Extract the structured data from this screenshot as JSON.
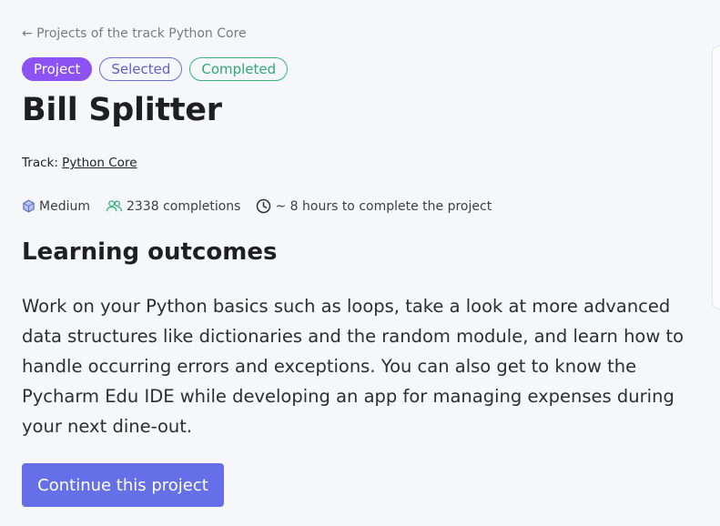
{
  "nav": {
    "back_label": "← Projects of the track Python Core"
  },
  "badges": {
    "project": "Project",
    "selected": "Selected",
    "completed": "Completed"
  },
  "project": {
    "title": "Bill Splitter",
    "track_label": "Track:",
    "track_name": "Python Core"
  },
  "meta": {
    "difficulty": "Medium",
    "completions": "2338 completions",
    "duration": "~ 8 hours to complete the project"
  },
  "outcomes": {
    "heading": "Learning outcomes",
    "text": "Work on your Python basics such as loops, take a look at more advanced data structures like dictionaries and the random module, and learn how to handle occurring errors and exceptions. You can also get to know the Pycharm Edu IDE while developing an app for managing expenses during your next dine-out."
  },
  "actions": {
    "continue_label": "Continue this project"
  },
  "icons": {
    "difficulty": "hexagon-icon",
    "completions": "users-icon",
    "duration": "clock-icon"
  },
  "colors": {
    "accent": "#6570e8",
    "project_badge": "#8c52f4",
    "completed_green": "#2fa771"
  }
}
